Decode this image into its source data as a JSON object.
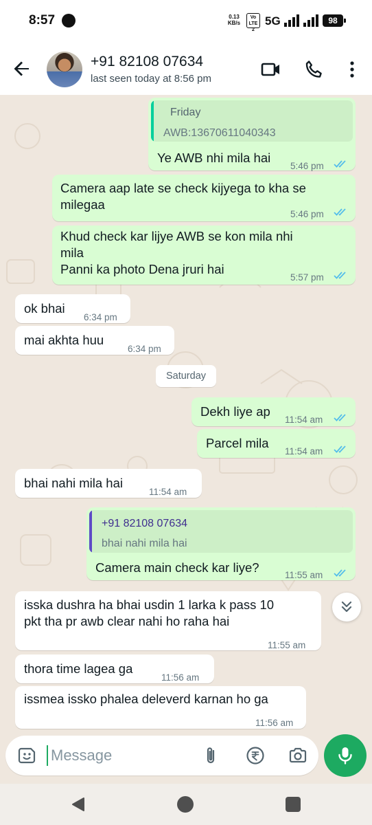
{
  "status_bar": {
    "time": "8:57",
    "data_speed_value": "0.13",
    "data_speed_unit": "KB/s",
    "volte_line1": "Vo",
    "volte_line2": "LTE 2",
    "network": "5G",
    "battery": "98"
  },
  "header": {
    "contact_name": "+91 82108 07634",
    "last_seen": "last seen today at 8:56 pm",
    "icons": [
      "back-arrow-icon",
      "video-call-icon",
      "phone-icon",
      "more-vert-icon"
    ]
  },
  "colors": {
    "outgoing_bubble": "#d9fdd3",
    "incoming_bubble": "#ffffff",
    "read_ticks": "#53bdeb",
    "accent_green": "#1daa61",
    "quote_bar_own": "#06cf9c",
    "quote_bar_contact": "#5e4bc6"
  },
  "messages": {
    "m1": {
      "direction": "outgoing",
      "quote_title": "Friday",
      "quote_body": "AWB:13670611040343",
      "text": "Ye AWB nhi mila hai",
      "time": "5:46 pm",
      "status": "read"
    },
    "m2": {
      "direction": "outgoing",
      "line1": "Camera aap late se check kijyega to kha se",
      "line2": "milegaa",
      "time": "5:46 pm",
      "status": "read"
    },
    "m3": {
      "direction": "outgoing",
      "line1": "Khud check kar lijye AWB se kon mila nhi",
      "line2": "mila",
      "line3": "Panni ka photo Dena jruri hai",
      "time": "5:57 pm",
      "status": "read"
    },
    "m4": {
      "direction": "incoming",
      "text": "ok bhai",
      "time": "6:34 pm"
    },
    "m5": {
      "direction": "incoming",
      "text": "mai akhta huu",
      "time": "6:34 pm"
    },
    "date_divider": "Saturday",
    "m6": {
      "direction": "outgoing",
      "text": "Dekh liye ap",
      "time": "11:54 am",
      "status": "read"
    },
    "m7": {
      "direction": "outgoing",
      "text": "Parcel mila",
      "time": "11:54 am",
      "status": "read"
    },
    "m8": {
      "direction": "incoming",
      "text": "bhai nahi mila hai",
      "time": "11:54 am"
    },
    "m9": {
      "direction": "outgoing",
      "quote_title": "+91 82108 07634",
      "quote_body": "bhai nahi mila hai",
      "text": "Camera main check kar liye?",
      "time": "11:55 am",
      "status": "read"
    },
    "m10": {
      "direction": "incoming",
      "line1": "isska dushra ha bhai usdin 1 larka k pass 10",
      "line2": "pkt tha pr awb clear nahi ho raha hai",
      "time": "11:55 am"
    },
    "m11": {
      "direction": "incoming",
      "text": "thora time lagea ga",
      "time": "11:56 am"
    },
    "m12": {
      "direction": "incoming",
      "text": "issmea issko phalea deleverd karnan ho ga",
      "time": "11:56 am"
    }
  },
  "composer": {
    "placeholder": "Message",
    "icons": [
      "emoji-sticker-icon",
      "attach-icon",
      "rupee-payment-icon",
      "camera-icon",
      "mic-icon"
    ]
  },
  "nav_bar": {
    "icons": [
      "nav-back-icon",
      "nav-home-icon",
      "nav-recents-icon"
    ]
  }
}
